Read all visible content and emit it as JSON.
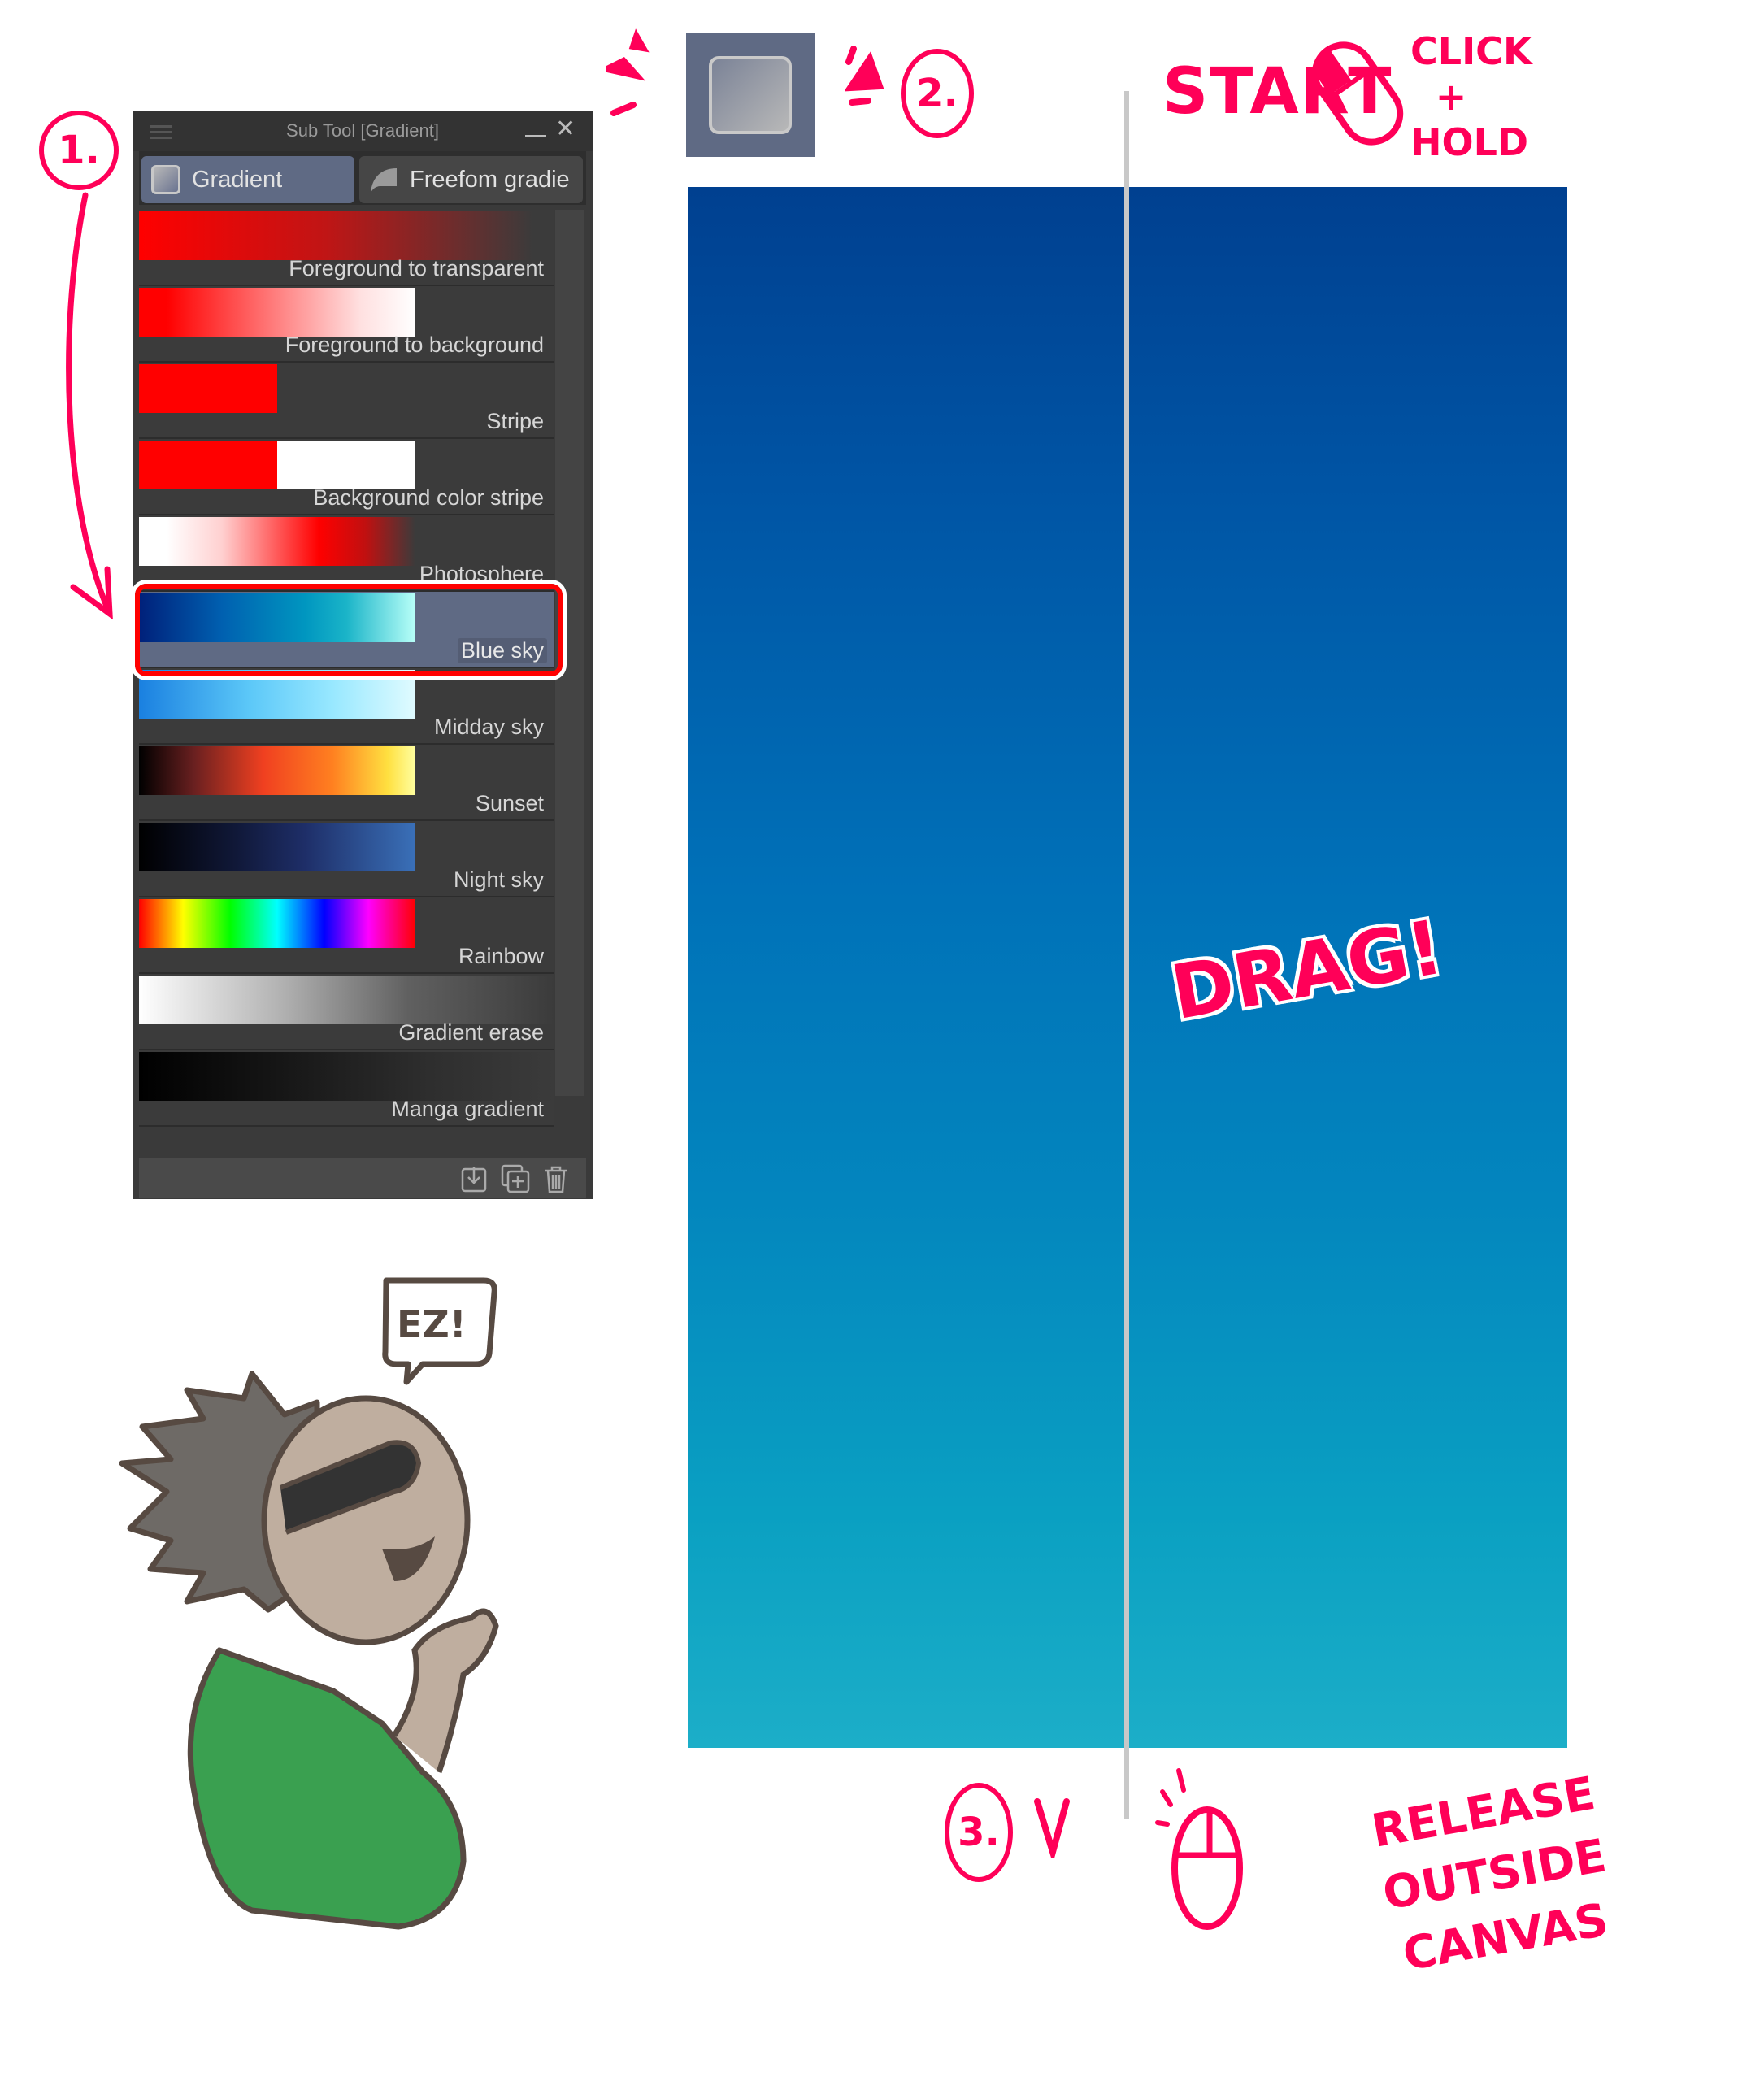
{
  "panel": {
    "title": "Sub Tool [Gradient]",
    "menu_icon": "hamburger-icon",
    "minimize_icon": "minimize-icon",
    "close_icon": "close-icon",
    "tabs": [
      {
        "label": "Gradient",
        "icon": "gradient-square-icon",
        "active": true
      },
      {
        "label": "Freefom gradie",
        "icon": "freeform-gradient-icon",
        "active": false
      }
    ],
    "items": [
      {
        "label": "Foreground to transparent",
        "gradient": "linear-gradient(90deg,#ff0000 0%,#c01515 45%,#3b3b3b 95%)",
        "swatch_fraction": 1.0,
        "selected": false
      },
      {
        "label": "Foreground to background",
        "gradient": "linear-gradient(90deg,#ff0000 10%,#ff6060 40%,#ffe0e0 80%,#ffffff 100%)",
        "swatch_fraction": 0.6,
        "selected": false
      },
      {
        "label": "Stripe",
        "gradient": "linear-gradient(90deg,#ff0000 0%,#ff0000 100%)",
        "swatch_fraction": 0.3,
        "selected": false
      },
      {
        "label": "Background color stripe",
        "gradient": "linear-gradient(90deg,#ff0000 0%,#ff0000 50%,#ffffff 50%,#ffffff 100%)",
        "swatch_fraction": 0.6,
        "selected": false
      },
      {
        "label": "Photosphere",
        "gradient": "linear-gradient(90deg,#ffffff 10%,#ffd0d0 30%,#ff0000 65%,#c01010 82%,#3b3b3b 100%)",
        "swatch_fraction": 0.6,
        "selected": false
      },
      {
        "label": "Blue sky",
        "gradient": "linear-gradient(90deg,#00207a 0%,#0060b0 30%,#0096c0 60%,#1ab4c8 75%,#b8fff8 100%)",
        "swatch_fraction": 0.6,
        "selected": true
      },
      {
        "label": "Midday sky",
        "gradient": "linear-gradient(90deg,#1a80e0 0%,#5cc8f8 40%,#98e8ff 70%,#e0fbff 100%)",
        "swatch_fraction": 0.6,
        "selected": false
      },
      {
        "label": "Sunset",
        "gradient": "linear-gradient(90deg,#000000 0%,#6a2020 20%,#f04020 45%,#ff8020 70%,#ffe040 90%,#ffffa0 100%)",
        "swatch_fraction": 0.6,
        "selected": false
      },
      {
        "label": "Night sky",
        "gradient": "linear-gradient(90deg,#000000 0%,#101838 35%,#1e2e68 60%,#3a70b8 100%)",
        "swatch_fraction": 0.6,
        "selected": false
      },
      {
        "label": "Rainbow",
        "gradient": "linear-gradient(90deg,#ff0000 0%,#ffff00 16%,#00ff00 33%,#00ffff 50%,#0000ff 67%,#ff00ff 83%,#ff0000 100%)",
        "swatch_fraction": 0.6,
        "selected": false
      },
      {
        "label": "Gradient erase",
        "gradient": "linear-gradient(90deg,#ffffff 0%,#b0b0b0 35%,#606060 65%,#3b3b3b 100%)",
        "swatch_fraction": 1.0,
        "selected": false
      },
      {
        "label": "Manga gradient",
        "gradient": "linear-gradient(90deg,#000000 0%,#1a1a1a 40%,#2e2e2e 70%,#3b3b3b 100%)",
        "swatch_fraction": 1.0,
        "selected": false
      }
    ],
    "footer_icons": [
      "download-icon",
      "duplicate-icon",
      "trash-icon"
    ]
  },
  "annotations": {
    "step1": "1.",
    "step2": "2.",
    "step3": "3.",
    "start": "START",
    "click_hold": [
      "CLICK",
      "+",
      "HOLD"
    ],
    "drag": "DRAG!",
    "release": [
      "RELEASE",
      "OUTSIDE",
      "CANVAS"
    ],
    "speech": "EZ!",
    "accent_color": "#ff0058"
  },
  "canvas": {
    "fill_top": "#004090",
    "fill_bottom": "#1caec8"
  }
}
